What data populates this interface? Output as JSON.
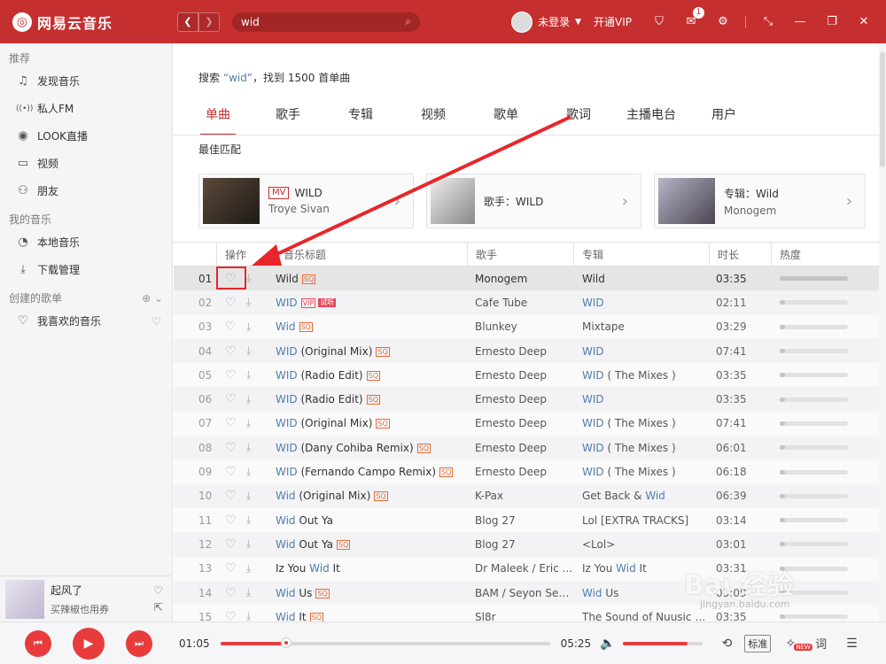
{
  "app": {
    "name": "网易云音乐",
    "logo_glyph": "◎",
    "brand_color": "#c62f2f"
  },
  "titlebar": {
    "search_value": "wid",
    "user_label": "未登录",
    "vip_label": "开通VIP",
    "message_badge": "1"
  },
  "sidebar": {
    "sections": [
      {
        "title": "推荐",
        "items": [
          {
            "icon": "music-note-icon",
            "glyph": "♫",
            "label": "发现音乐"
          },
          {
            "icon": "radio-icon",
            "glyph": "((•))",
            "label": "私人FM"
          },
          {
            "icon": "live-icon",
            "glyph": "◉",
            "label": "LOOK直播"
          },
          {
            "icon": "video-icon",
            "glyph": "▭",
            "label": "视频"
          },
          {
            "icon": "friends-icon",
            "glyph": "⚇",
            "label": "朋友"
          }
        ]
      },
      {
        "title": "我的音乐",
        "items": [
          {
            "icon": "local-music-icon",
            "glyph": "◔",
            "label": "本地音乐"
          },
          {
            "icon": "download-icon",
            "glyph": "⤓",
            "label": "下载管理"
          }
        ]
      },
      {
        "title": "创建的歌单",
        "items": [
          {
            "icon": "heart-icon",
            "glyph": "♡",
            "label": "我喜欢的音乐"
          }
        ]
      }
    ]
  },
  "now_playing": {
    "title": "起风了",
    "artist": "买辣椒也用券"
  },
  "search": {
    "summary_prefix": "搜索 ",
    "keyword": "“wid”",
    "summary_suffix": "，找到 1500 首单曲",
    "tabs": [
      "单曲",
      "歌手",
      "专辑",
      "视频",
      "歌单",
      "歌词",
      "主播电台",
      "用户"
    ],
    "active_tab": 0,
    "best_match_label": "最佳匹配",
    "best": [
      {
        "tag": "MV",
        "title": "WILD",
        "subtitle": "Troye Sivan"
      },
      {
        "title": "歌手：WILD"
      },
      {
        "title": "专辑：Wild",
        "subtitle": "Monogem"
      }
    ]
  },
  "table": {
    "headers": [
      "操作",
      "音乐标题",
      "歌手",
      "专辑",
      "时长",
      "热度"
    ],
    "rows": [
      {
        "idx": "01",
        "title": [
          {
            "t": "Wild",
            "h": false
          }
        ],
        "tags": [
          "SQ"
        ],
        "artist": "Monogem",
        "album": [
          {
            "t": "Wild",
            "h": false
          }
        ],
        "duration": "03:35",
        "heat": 1.0,
        "selected": true
      },
      {
        "idx": "02",
        "title": [
          {
            "t": "WID",
            "h": true
          }
        ],
        "tags": [
          "VIP",
          "试听"
        ],
        "artist": "Cafe Tube",
        "album": [
          {
            "t": "WID",
            "h": true
          }
        ],
        "duration": "02:11",
        "heat": 0.08
      },
      {
        "idx": "03",
        "title": [
          {
            "t": "Wid",
            "h": true
          }
        ],
        "tags": [
          "SQ"
        ],
        "artist": "Blunkey",
        "album": [
          {
            "t": "Mixtape",
            "h": false
          }
        ],
        "duration": "03:29",
        "heat": 0.08
      },
      {
        "idx": "04",
        "title": [
          {
            "t": "WID",
            "h": true
          },
          {
            "t": " (Original Mix)",
            "h": false
          }
        ],
        "tags": [
          "SQ"
        ],
        "artist": "Ernesto Deep",
        "album": [
          {
            "t": "WID",
            "h": true
          }
        ],
        "duration": "07:41",
        "heat": 0.08
      },
      {
        "idx": "05",
        "title": [
          {
            "t": "WID",
            "h": true
          },
          {
            "t": " (Radio Edit)",
            "h": false
          }
        ],
        "tags": [
          "SQ"
        ],
        "artist": "Ernesto Deep",
        "album": [
          {
            "t": "WID",
            "h": true
          },
          {
            "t": " ( The Mixes )",
            "h": false
          }
        ],
        "duration": "03:35",
        "heat": 0.08
      },
      {
        "idx": "06",
        "title": [
          {
            "t": "WID",
            "h": true
          },
          {
            "t": " (Radio Edit)",
            "h": false
          }
        ],
        "tags": [
          "SQ"
        ],
        "artist": "Ernesto Deep",
        "album": [
          {
            "t": "WID",
            "h": true
          }
        ],
        "duration": "03:35",
        "heat": 0.08
      },
      {
        "idx": "07",
        "title": [
          {
            "t": "WID",
            "h": true
          },
          {
            "t": " (Original Mix)",
            "h": false
          }
        ],
        "tags": [
          "SQ"
        ],
        "artist": "Ernesto Deep",
        "album": [
          {
            "t": "WID",
            "h": true
          },
          {
            "t": " ( The Mixes )",
            "h": false
          }
        ],
        "duration": "07:41",
        "heat": 0.08
      },
      {
        "idx": "08",
        "title": [
          {
            "t": "WID",
            "h": true
          },
          {
            "t": " (Dany Cohiba Remix)",
            "h": false
          }
        ],
        "tags": [
          "SQ"
        ],
        "artist": "Ernesto Deep",
        "album": [
          {
            "t": "WID",
            "h": true
          },
          {
            "t": " ( The Mixes )",
            "h": false
          }
        ],
        "duration": "06:01",
        "heat": 0.08
      },
      {
        "idx": "09",
        "title": [
          {
            "t": "WID",
            "h": true
          },
          {
            "t": " (Fernando Campo Remix)",
            "h": false
          }
        ],
        "tags": [
          "SQ"
        ],
        "artist": "Ernesto Deep",
        "album": [
          {
            "t": "WID",
            "h": true
          },
          {
            "t": " ( The Mixes )",
            "h": false
          }
        ],
        "duration": "06:18",
        "heat": 0.08
      },
      {
        "idx": "10",
        "title": [
          {
            "t": "Wid",
            "h": true
          },
          {
            "t": " (Original Mix)",
            "h": false
          }
        ],
        "tags": [
          "SQ"
        ],
        "artist": "K-Pax",
        "album": [
          {
            "t": "Get Back & ",
            "h": false
          },
          {
            "t": "Wid",
            "h": true
          }
        ],
        "duration": "06:39",
        "heat": 0.08
      },
      {
        "idx": "11",
        "title": [
          {
            "t": "Wid",
            "h": true
          },
          {
            "t": " Out Ya",
            "h": false
          }
        ],
        "tags": [],
        "artist": "Blog 27",
        "album": [
          {
            "t": "Lol [EXTRA TRACKS]",
            "h": false
          }
        ],
        "duration": "03:14",
        "heat": 0.08
      },
      {
        "idx": "12",
        "title": [
          {
            "t": "Wid",
            "h": true
          },
          {
            "t": " Out Ya",
            "h": false
          }
        ],
        "tags": [
          "SQ"
        ],
        "artist": "Blog 27",
        "album": [
          {
            "t": "<Lol>",
            "h": false
          }
        ],
        "duration": "03:01",
        "heat": 0.08
      },
      {
        "idx": "13",
        "title": [
          {
            "t": "Iz You ",
            "h": false
          },
          {
            "t": "Wid",
            "h": true
          },
          {
            "t": " It",
            "h": false
          }
        ],
        "tags": [],
        "artist": "Dr Maleek / Eric ...",
        "album": [
          {
            "t": "Iz You ",
            "h": false
          },
          {
            "t": "Wid",
            "h": true
          },
          {
            "t": " It",
            "h": false
          }
        ],
        "duration": "03:31",
        "heat": 0.08
      },
      {
        "idx": "14",
        "title": [
          {
            "t": "Wid",
            "h": true
          },
          {
            "t": " Us",
            "h": false
          }
        ],
        "tags": [
          "SQ"
        ],
        "artist": "BAM / Seyon Sev...",
        "album": [
          {
            "t": "Wid",
            "h": true
          },
          {
            "t": " Us",
            "h": false
          }
        ],
        "duration": "03:09",
        "heat": 0.08
      },
      {
        "idx": "15",
        "title": [
          {
            "t": "Wid",
            "h": true
          },
          {
            "t": " It",
            "h": false
          }
        ],
        "tags": [
          "SQ"
        ],
        "artist": "Sl8r",
        "album": [
          {
            "t": "The Sound of Nuusic V...",
            "h": false
          }
        ],
        "duration": "03:35",
        "heat": 0.08
      }
    ]
  },
  "player": {
    "elapsed": "01:05",
    "total": "05:25",
    "progress": 0.2,
    "volume": 0.82,
    "mode_label": "标准",
    "lyrics_label": "词",
    "new_tag": "NEW"
  },
  "watermark": {
    "text": "Bai 经验",
    "sub": "jingyan.baidu.com"
  }
}
